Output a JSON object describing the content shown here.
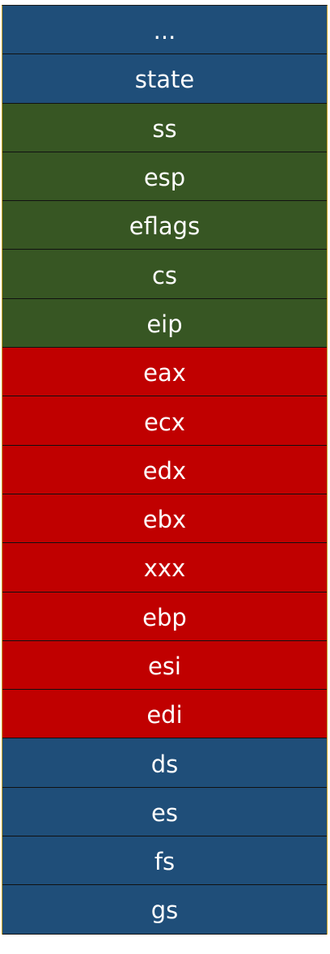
{
  "colors": {
    "blue": "#1f4e79",
    "green": "#375623",
    "red": "#c00000"
  },
  "stack": {
    "cells": [
      {
        "label": "...",
        "color": "blue"
      },
      {
        "label": "state",
        "color": "blue"
      },
      {
        "label": "ss",
        "color": "green"
      },
      {
        "label": "esp",
        "color": "green"
      },
      {
        "label": "eflags",
        "color": "green"
      },
      {
        "label": "cs",
        "color": "green"
      },
      {
        "label": "eip",
        "color": "green"
      },
      {
        "label": "eax",
        "color": "red"
      },
      {
        "label": "ecx",
        "color": "red"
      },
      {
        "label": "edx",
        "color": "red"
      },
      {
        "label": "ebx",
        "color": "red"
      },
      {
        "label": "xxx",
        "color": "red"
      },
      {
        "label": "ebp",
        "color": "red"
      },
      {
        "label": "esi",
        "color": "red"
      },
      {
        "label": "edi",
        "color": "red"
      },
      {
        "label": "ds",
        "color": "blue"
      },
      {
        "label": "es",
        "color": "blue"
      },
      {
        "label": "fs",
        "color": "blue"
      },
      {
        "label": "gs",
        "color": "blue"
      }
    ]
  }
}
